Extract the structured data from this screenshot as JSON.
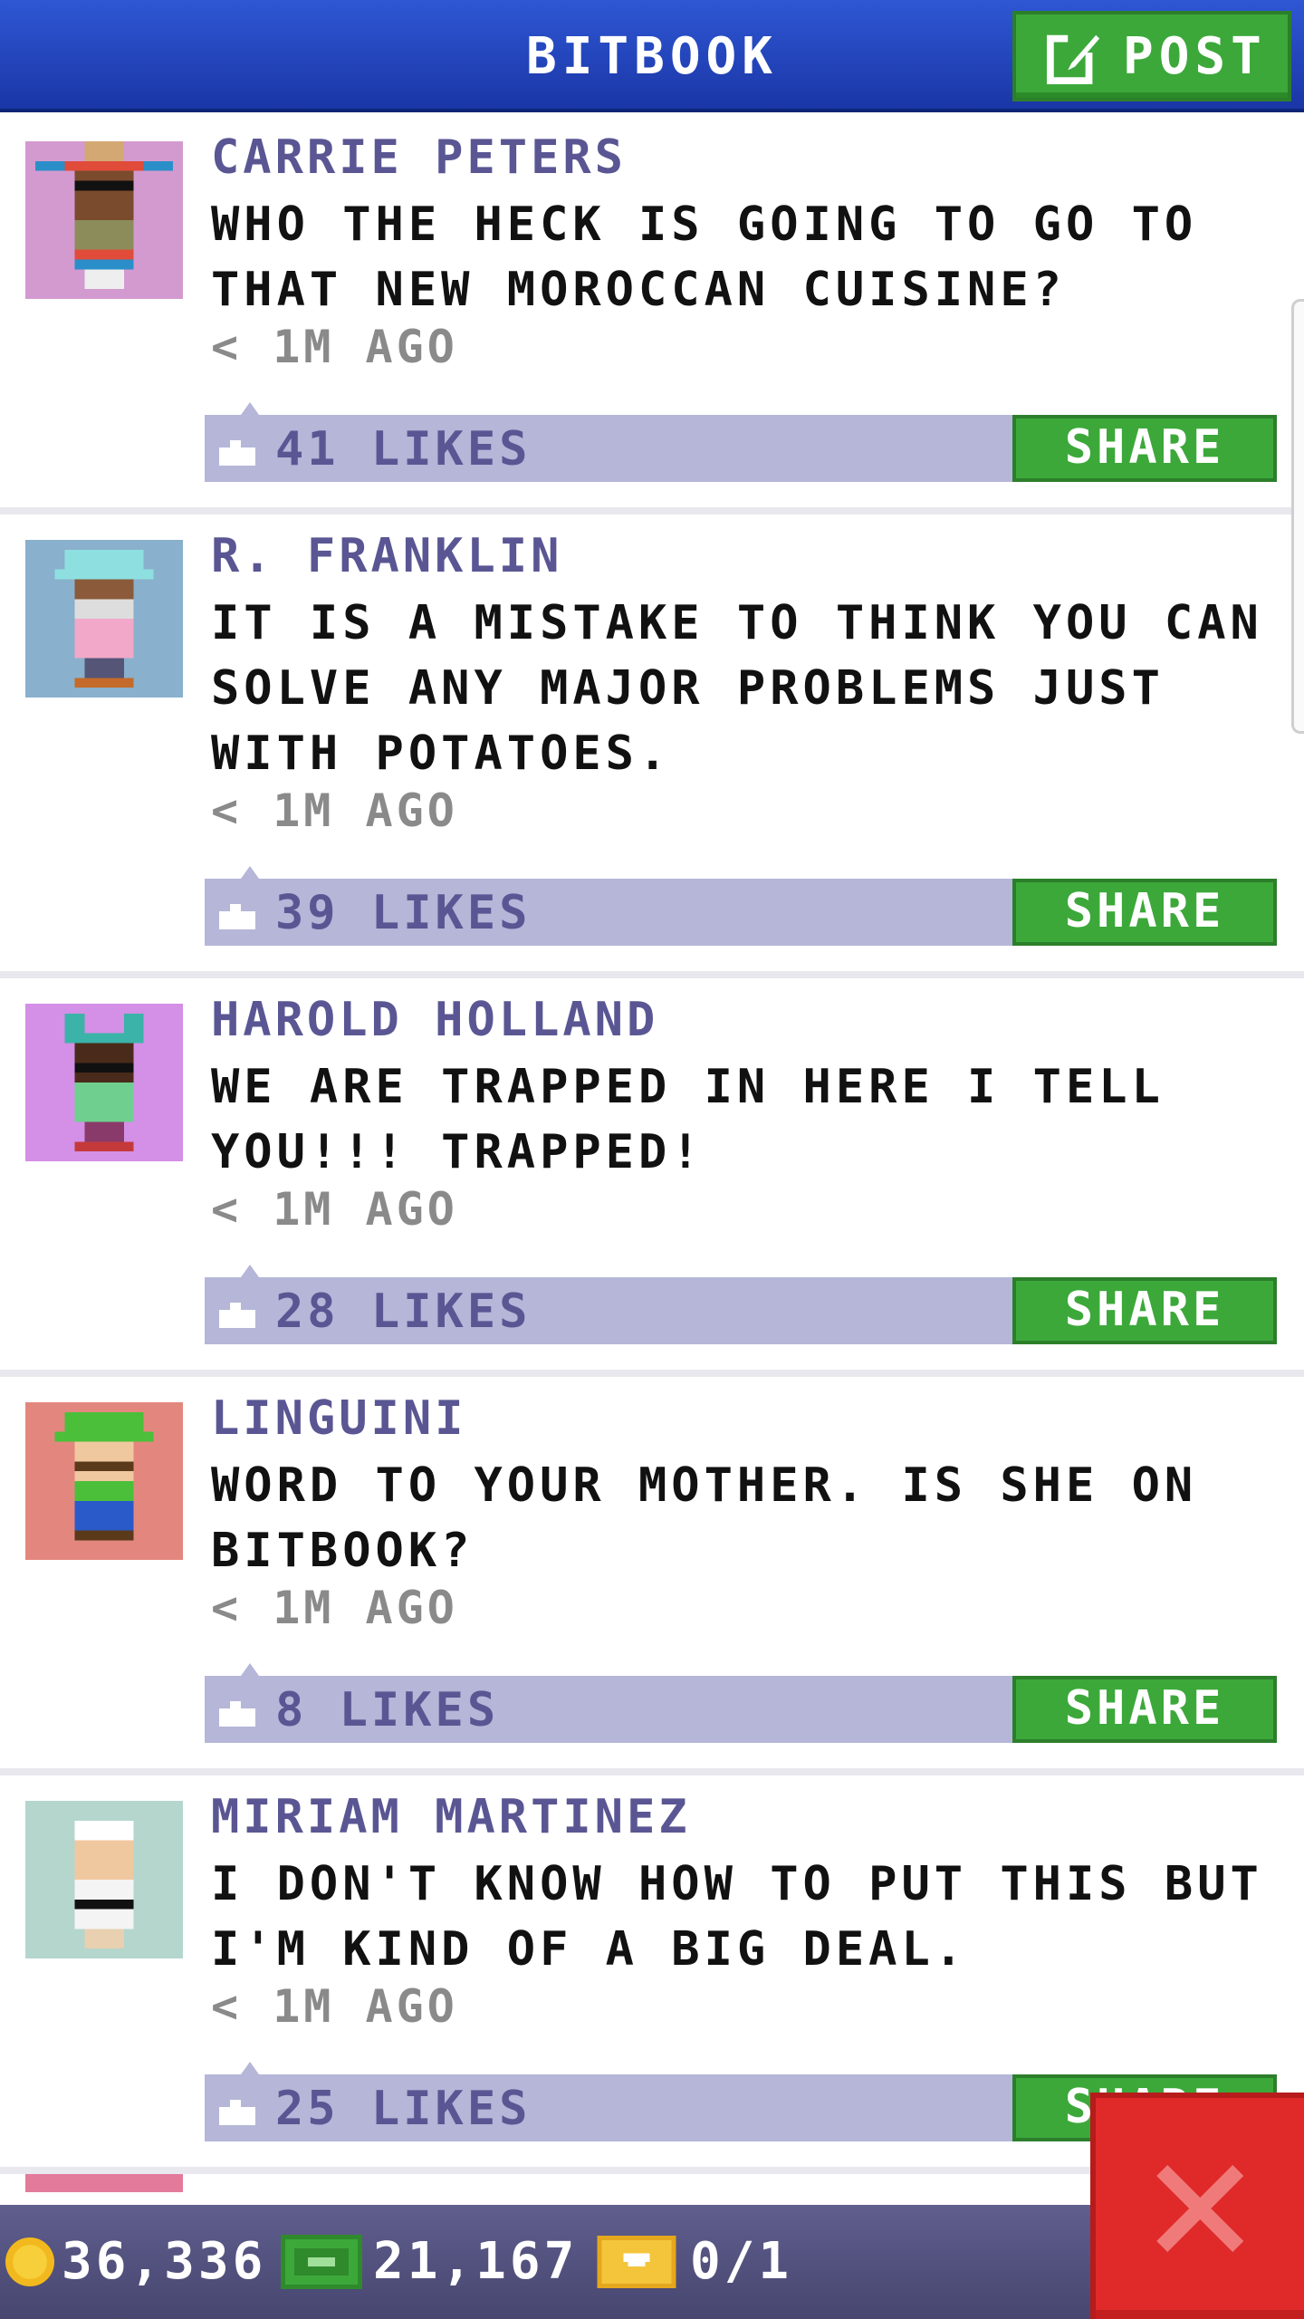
{
  "header": {
    "title": "BITBOOK",
    "post_label": "POST"
  },
  "posts": [
    {
      "author": "CARRIE PETERS",
      "text": "WHO THE HECK IS GOING TO GO TO THAT NEW MOROCCAN CUISINE?",
      "time": "< 1M AGO",
      "likes": "41 LIKES",
      "share_label": "SHARE",
      "avatar_bg": "#d39ad0"
    },
    {
      "author": "R. FRANKLIN",
      "text": "IT IS A MISTAKE TO THINK YOU CAN SOLVE ANY MAJOR PROBLEMS JUST WITH POTATOES.",
      "time": "< 1M AGO",
      "likes": "39 LIKES",
      "share_label": "SHARE",
      "avatar_bg": "#89b0cc"
    },
    {
      "author": "HAROLD HOLLAND",
      "text": "WE ARE TRAPPED IN HERE I TELL YOU!!! TRAPPED!",
      "time": "< 1M AGO",
      "likes": "28 LIKES",
      "share_label": "SHARE",
      "avatar_bg": "#d48fe6"
    },
    {
      "author": "LINGUINI",
      "text": "WORD TO YOUR MOTHER. IS SHE ON BITBOOK?",
      "time": "< 1M AGO",
      "likes": "8 LIKES",
      "share_label": "SHARE",
      "avatar_bg": "#e3877e"
    },
    {
      "author": "MIRIAM MARTINEZ",
      "text": "I DON'T KNOW HOW TO PUT THIS BUT I'M KIND OF A BIG DEAL.",
      "time": "< 1M AGO",
      "likes": "25 LIKES",
      "share_label": "SHARE",
      "avatar_bg": "#b4d6cd"
    }
  ],
  "stats": {
    "coins": "36,336",
    "bux": "21,167",
    "tickets": "0/1"
  },
  "colors": {
    "header_blue": "#2f57d4",
    "accent_green": "#3ca83a",
    "likes_bar": "#b5b6d8",
    "name_purple": "#5a5693",
    "close_red": "#e02a2a"
  }
}
